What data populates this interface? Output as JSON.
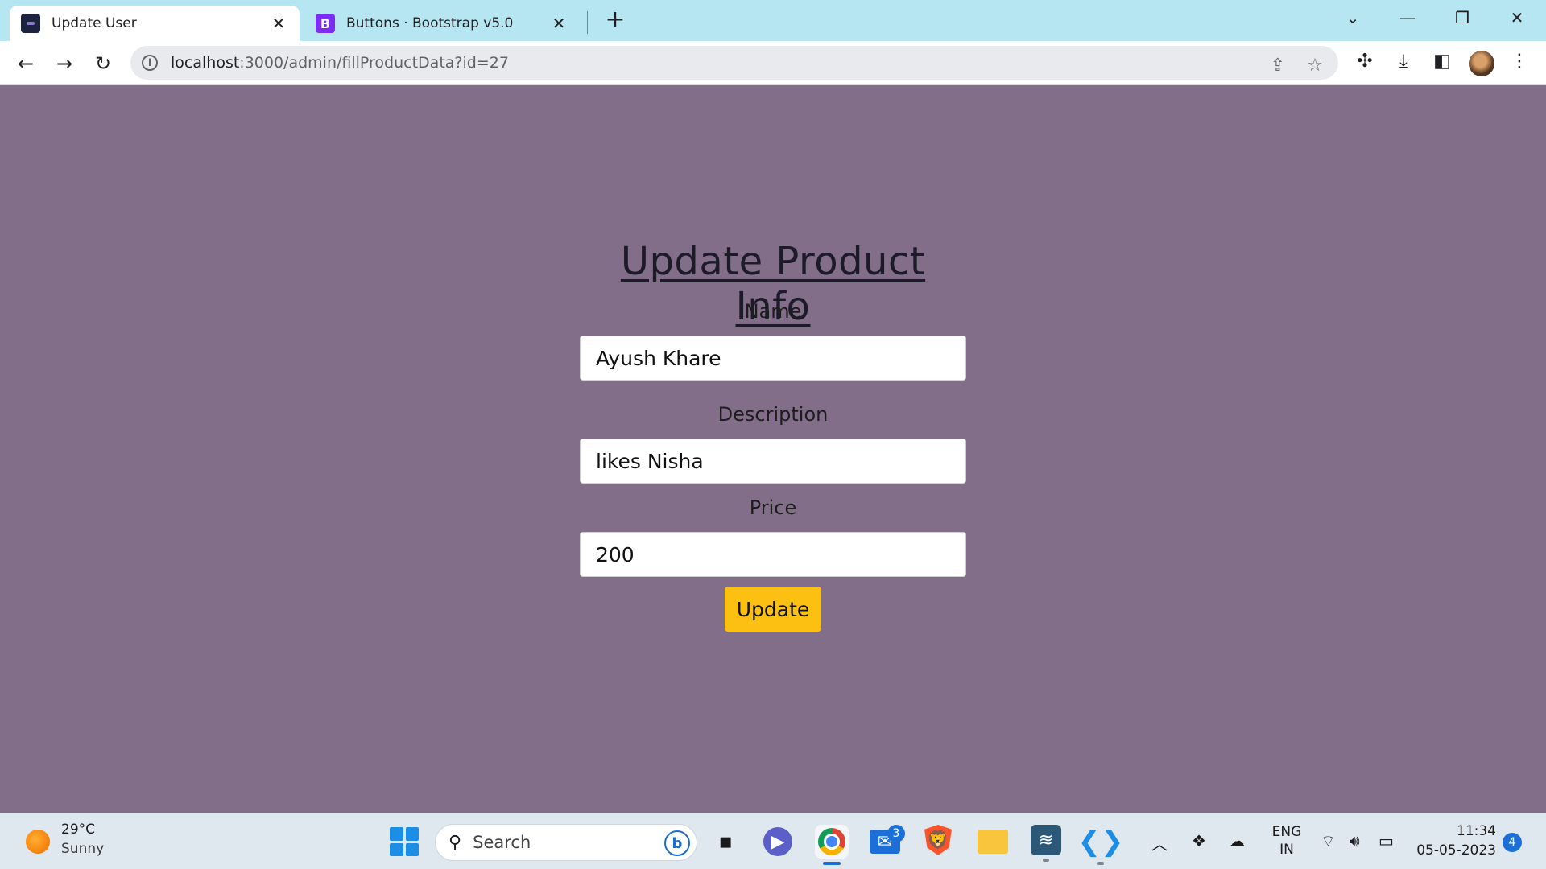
{
  "browser": {
    "tabs": [
      {
        "title": "Update User",
        "active": true,
        "favicon": "site-icon"
      },
      {
        "title": "Buttons · Bootstrap v5.0",
        "active": false,
        "favicon": "bootstrap-icon",
        "favicon_letter": "B"
      }
    ],
    "url_host": "localhost",
    "url_rest": ":3000/admin/fillProductData?id=27"
  },
  "page": {
    "heading": "Update Product Info",
    "name_label": "Name",
    "name_value": "Ayush Khare",
    "description_label": "Description",
    "description_value": "likes Nisha",
    "price_label": "Price",
    "price_value": "200",
    "submit_label": "Update"
  },
  "taskbar": {
    "weather_temp": "29°C",
    "weather_desc": "Sunny",
    "search_placeholder": "Search",
    "mail_badge": "3",
    "lang_line1": "ENG",
    "lang_line2": "IN",
    "time": "11:34",
    "date": "05-05-2023",
    "notification_count": "4"
  },
  "colors": {
    "page_background": "#826e88",
    "tabbar": "#b6e6f2",
    "update_button": "#fbc012"
  }
}
